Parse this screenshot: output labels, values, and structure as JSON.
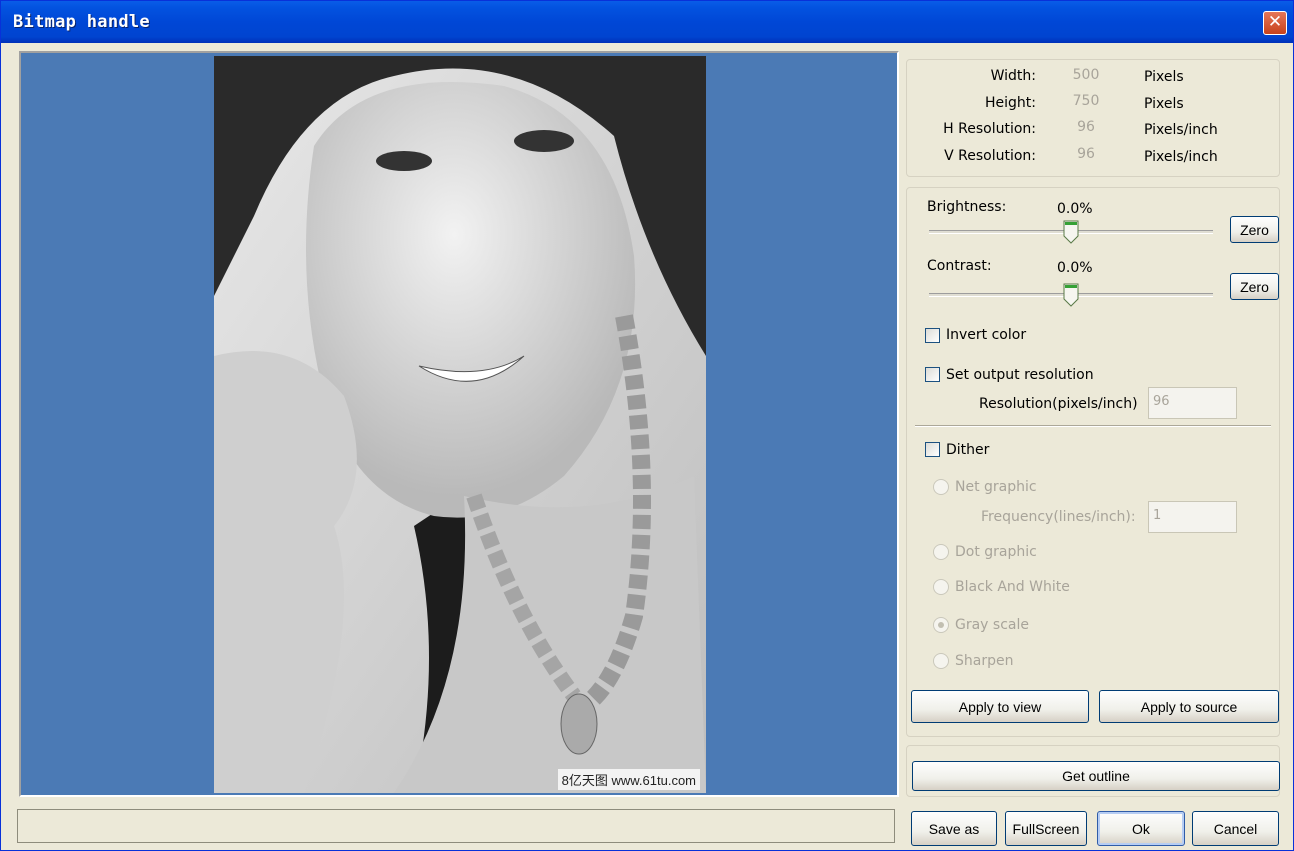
{
  "window": {
    "title": "Bitmap handle",
    "close_glyph": "✕"
  },
  "image": {
    "watermark": "8亿天图 www.61tu.com",
    "alt": "portrait"
  },
  "info": {
    "width_label": "Width:",
    "width_value": "500",
    "width_unit": "Pixels",
    "height_label": "Height:",
    "height_value": "750",
    "height_unit": "Pixels",
    "hres_label": "H Resolution:",
    "hres_value": "96",
    "hres_unit": "Pixels/inch",
    "vres_label": "V Resolution:",
    "vres_value": "96",
    "vres_unit": "Pixels/inch"
  },
  "adjust": {
    "brightness_label": "Brightness:",
    "brightness_value": "0.0%",
    "contrast_label": "Contrast:",
    "contrast_value": "0.0%",
    "zero_label": "Zero",
    "invert_label": "Invert color",
    "set_output_label": "Set output resolution",
    "resolution_label": "Resolution(pixels/inch)",
    "resolution_value": "96",
    "dither_label": "Dither",
    "net_graphic_label": "Net graphic",
    "frequency_label": "Frequency(lines/inch):",
    "frequency_value": "1",
    "dot_graphic_label": "Dot graphic",
    "bw_label": "Black And White",
    "gray_label": "Gray scale",
    "sharpen_label": "Sharpen",
    "apply_view_label": "Apply to view",
    "apply_source_label": "Apply to source"
  },
  "outline": {
    "get_outline_label": "Get outline"
  },
  "footer": {
    "save_as": "Save as",
    "fullscreen": "FullScreen",
    "ok": "Ok",
    "cancel": "Cancel"
  }
}
